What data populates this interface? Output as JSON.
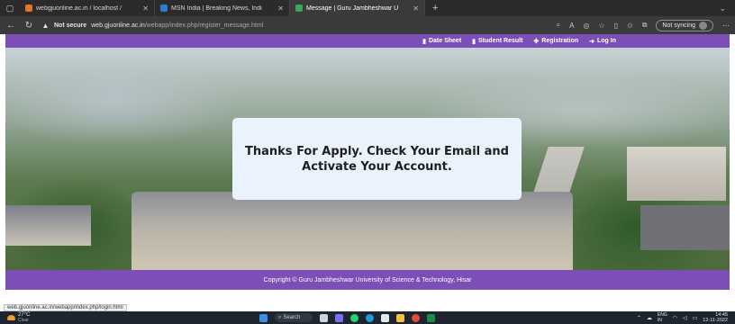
{
  "browser": {
    "tabs": [
      {
        "label": "webgjuonline.ac.in / localhost /",
        "favicon_color": "#e8742a",
        "active": false
      },
      {
        "label": "MSN India | Breaking News, Indi",
        "favicon_color": "#2b7cd3",
        "active": false
      },
      {
        "label": "Message | Guru Jambheshwar U",
        "favicon_color": "#3aa757",
        "active": true
      }
    ],
    "address": {
      "security_label": "Not secure",
      "url_host": "web.gjuonline.ac.in",
      "url_path": "/webapp/index.php/register_message.html"
    },
    "sync_label": "Not syncing"
  },
  "site": {
    "nav": [
      {
        "label": "Date Sheet",
        "icon": "document-icon"
      },
      {
        "label": "Student Result",
        "icon": "document-icon"
      },
      {
        "label": "Registration",
        "icon": "user-plus-icon"
      },
      {
        "label": "Log In",
        "icon": "login-icon"
      }
    ],
    "message": "Thanks For Apply. Check Your Email and Activate Your Account.",
    "footer": "Copyright © Guru Jambheshwar University of Science & Technology, Hisar"
  },
  "status_url": "web.gjuonline.ac.in/webapp/index.php/login.html",
  "taskbar": {
    "weather_temp": "27°C",
    "weather_desc": "Clear",
    "search_label": "Search",
    "lang": "ENG",
    "lang_sub": "IN",
    "time": "14:45",
    "date": "12-11-2022"
  },
  "colors": {
    "nav_bg": "#7b4fb5",
    "message_bg": "#eaf2fb"
  }
}
